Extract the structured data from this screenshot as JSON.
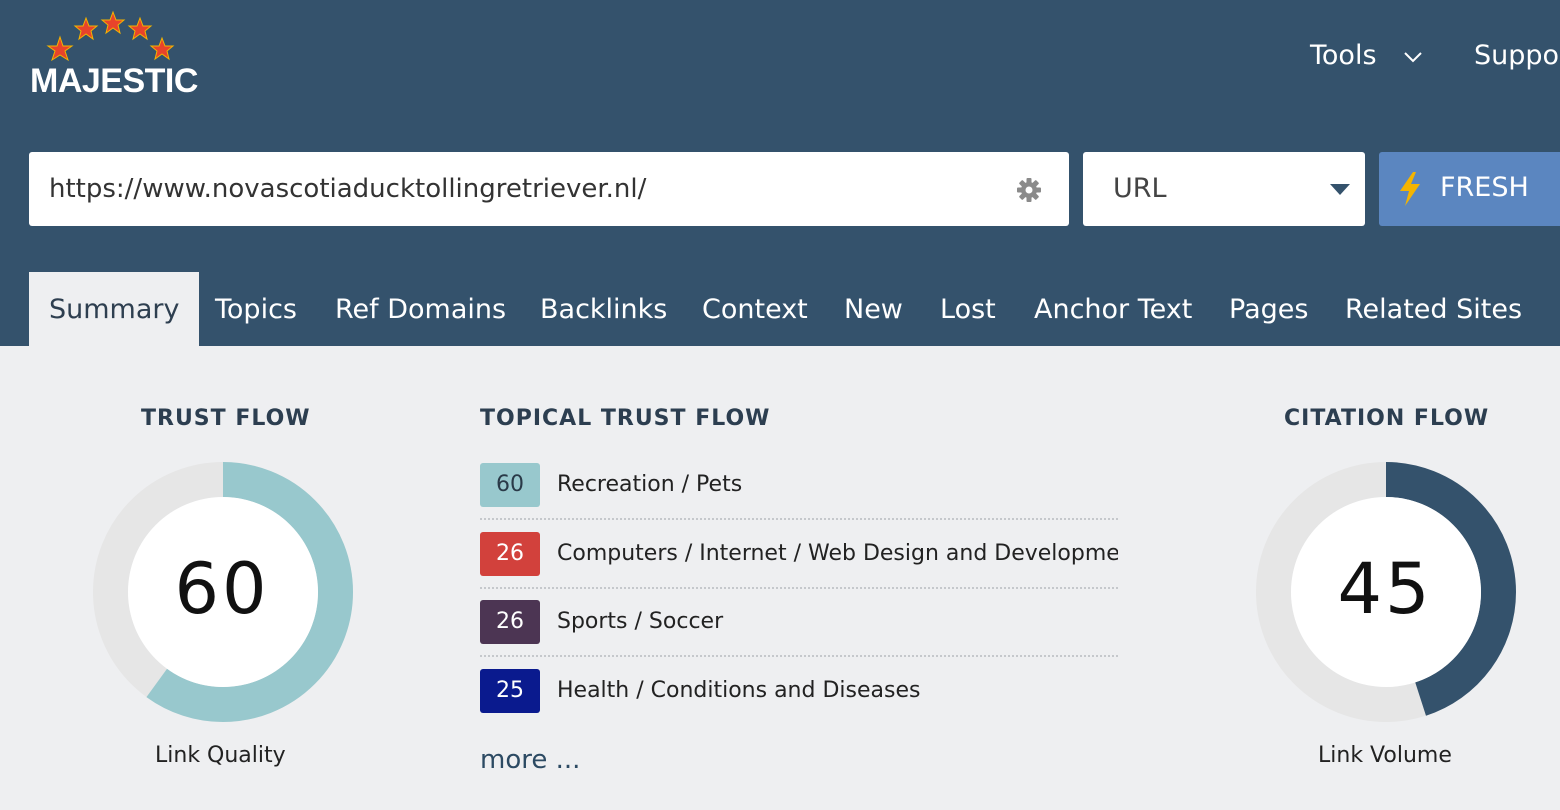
{
  "brand": {
    "name": "MAJESTIC"
  },
  "nav": {
    "tools": "Tools",
    "support": "Suppor"
  },
  "search": {
    "value": "https://www.novascotiaducktollingretriever.nl/"
  },
  "scope_select": {
    "selected": "URL"
  },
  "fresh_button": {
    "label": "FRESH"
  },
  "tabs": [
    {
      "label": "Summary",
      "active": true
    },
    {
      "label": "Topics"
    },
    {
      "label": "Ref Domains"
    },
    {
      "label": "Backlinks"
    },
    {
      "label": "Context"
    },
    {
      "label": "New"
    },
    {
      "label": "Lost"
    },
    {
      "label": "Anchor Text"
    },
    {
      "label": "Pages"
    },
    {
      "label": "Related Sites"
    }
  ],
  "trust_flow": {
    "title": "TRUST FLOW",
    "value": "60",
    "fraction": 0.6,
    "caption": "Link Quality",
    "color": "#98c8cd"
  },
  "topical_trust_flow": {
    "title": "TOPICAL TRUST FLOW",
    "topics": [
      {
        "score": "60",
        "label": "Recreation / Pets",
        "color": "#98c8cd",
        "text_color": "#2a3a48"
      },
      {
        "score": "26",
        "label": "Computers / Internet / Web Design and Development",
        "color": "#d2413c",
        "text_color": "#ffffff"
      },
      {
        "score": "26",
        "label": "Sports / Soccer",
        "color": "#4c3553",
        "text_color": "#ffffff"
      },
      {
        "score": "25",
        "label": "Health / Conditions and Diseases",
        "color": "#0a1a8e",
        "text_color": "#ffffff"
      }
    ],
    "more": "more ..."
  },
  "citation_flow": {
    "title": "CITATION FLOW",
    "value": "45",
    "fraction": 0.45,
    "caption": "Link Volume",
    "color": "#34526c"
  },
  "colors": {
    "header": "#34526c",
    "page_bg": "#eeeff1",
    "fresh": "#5b86c0",
    "track": "#e6e6e6"
  }
}
